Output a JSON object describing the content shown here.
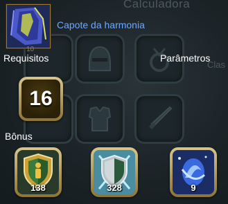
{
  "background": {
    "title": "Calculadora",
    "side_text": "Clas"
  },
  "item": {
    "icon": "cloak-icon",
    "name": "Capote da harmonia",
    "level": "10"
  },
  "labels": {
    "requirements": "Requisitos",
    "parameters": "Parâmetros",
    "bonus": "Bônus"
  },
  "requirement": {
    "level": "16"
  },
  "bonuses": [
    {
      "icon": "vitality-shield-icon",
      "value": "138"
    },
    {
      "icon": "defense-shield-icon",
      "value": "328"
    },
    {
      "icon": "water-orb-icon",
      "value": "9"
    }
  ],
  "colors": {
    "item_name": "#6fa6ff",
    "frame_gold": "#c9b273",
    "background": "#1a2226"
  }
}
